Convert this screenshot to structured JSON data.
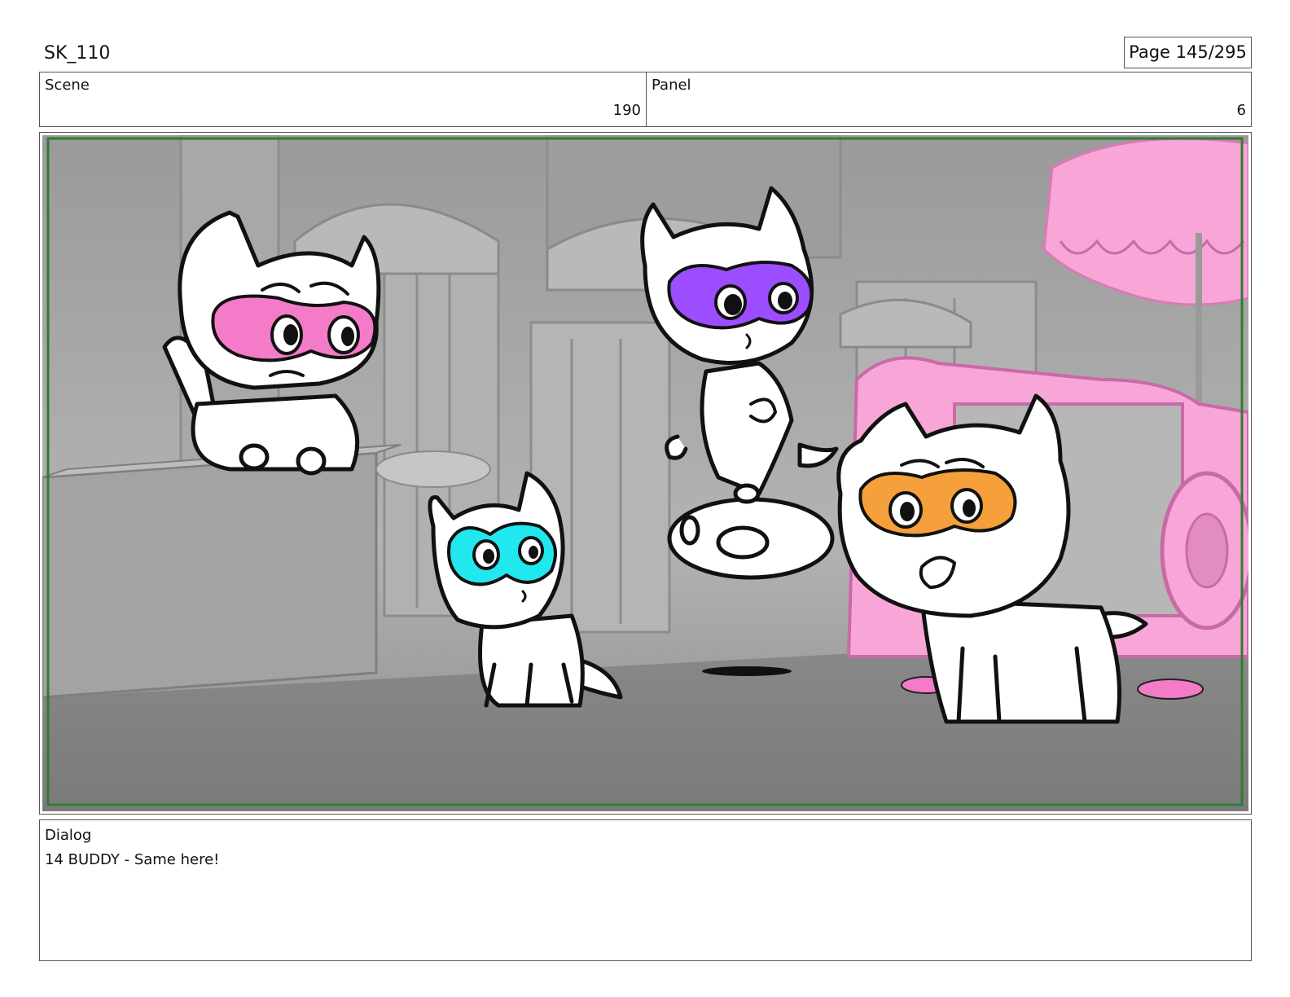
{
  "header": {
    "project_code": "SK_110",
    "page_label": "Page 145/295"
  },
  "scene": {
    "label": "Scene",
    "value": "190"
  },
  "panel": {
    "label": "Panel",
    "value": "6"
  },
  "dialog": {
    "label": "Dialog",
    "text": "14 BUDDY - Same here!"
  },
  "colors": {
    "safe_frame": "#2e7d32",
    "mask_pink": "#f47bc8",
    "mask_purple": "#9b4dff",
    "mask_cyan": "#20e8ee",
    "mask_orange": "#f5a03a",
    "prop_pink": "#f7a6d7",
    "background_gray": "#a9a9a9"
  }
}
